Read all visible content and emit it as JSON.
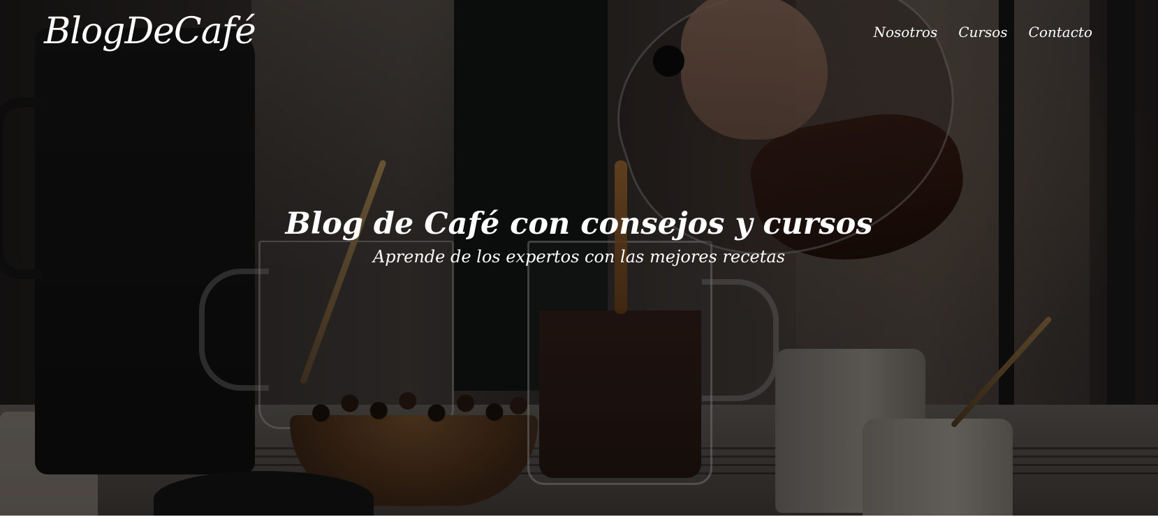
{
  "header": {
    "logo": "BlogDeCafé",
    "nav": [
      {
        "label": "Nosotros"
      },
      {
        "label": "Cursos"
      },
      {
        "label": "Contacto"
      }
    ]
  },
  "hero": {
    "title": "Blog de Café con consejos y cursos",
    "subtitle": "Aprende de los expertos con las mejores recetas",
    "background_image": "coffee-pouring-scene"
  },
  "colors": {
    "text": "#ffffff",
    "overlay": "#000000",
    "page_background": "#ffffff"
  }
}
